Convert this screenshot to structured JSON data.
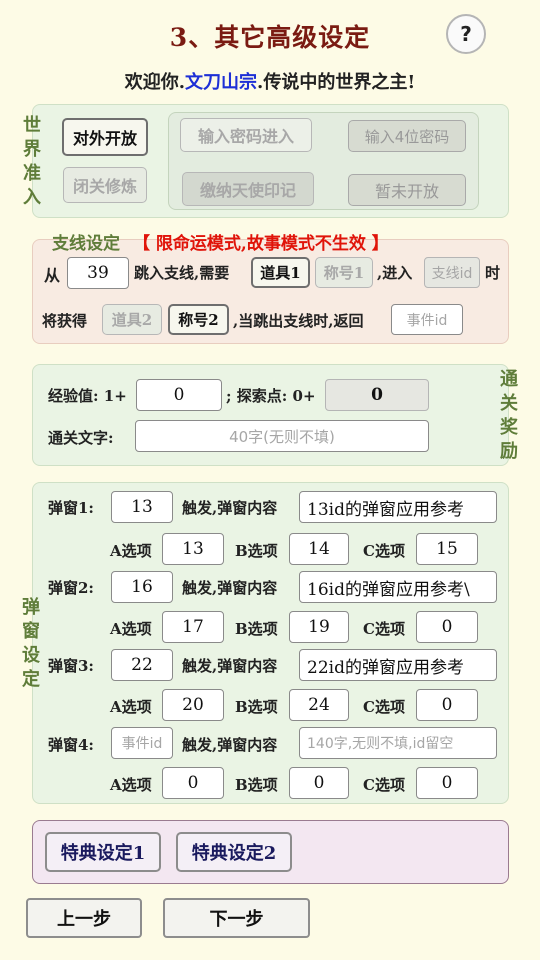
{
  "header": {
    "title": "3、其它高级设定",
    "help_label": "?",
    "welcome_prefix": "欢迎你.",
    "welcome_name": "文刀山宗",
    "welcome_suffix": ".传说中的世界之主!"
  },
  "world_access": {
    "side_label": [
      "世",
      "界",
      "准",
      "入"
    ],
    "open_button": "对外开放",
    "password_entry_button": "输入密码进入",
    "password_input_placeholder": "输入4位密码",
    "closed_button": "闭关修炼",
    "envoy_seal_button": "缴纳天使印记",
    "not_open_button": "暂未开放"
  },
  "branch": {
    "title": "支线设定",
    "warning": "【 限命运模式,故事模式不生效 】",
    "from_label": "从",
    "from_value": "39",
    "jump_label": "跳入支线,需要",
    "item1_button": "道具1",
    "title1_button": "称号1",
    "enter_label": ",进入",
    "branch_id_placeholder": "支线id",
    "when_label": "时",
    "gain_label": "将获得",
    "item2_button": "道具2",
    "title2_button": "称号2",
    "return_label": ",当跳出支线时,返回",
    "event_id_placeholder": "事件id"
  },
  "reward": {
    "side_label": [
      "通",
      "关",
      "奖",
      "励"
    ],
    "exp_label": "经验值: 1+",
    "exp_value": "0",
    "explore_label": "; 探索点: 0+",
    "explore_value": "0",
    "text_label": "通关文字:",
    "text_placeholder": "40字(无则不填)"
  },
  "popups": {
    "side_label": [
      "弹",
      "窗",
      "设",
      "定"
    ],
    "trigger_label": "触发,弹窗内容",
    "a_label": "A选项",
    "b_label": "B选项",
    "c_label": "C选项",
    "items": [
      {
        "label": "弹窗1:",
        "trigger": "13",
        "content": "13id的弹窗应用参考",
        "a": "13",
        "b": "14",
        "c": "15"
      },
      {
        "label": "弹窗2:",
        "trigger": "16",
        "content": "16id的弹窗应用参考\\",
        "a": "17",
        "b": "19",
        "c": "0"
      },
      {
        "label": "弹窗3:",
        "trigger": "22",
        "content": "22id的弹窗应用参考",
        "a": "20",
        "b": "24",
        "c": "0"
      },
      {
        "label": "弹窗4:",
        "trigger": "",
        "trigger_placeholder": "事件id",
        "content": "",
        "content_placeholder": "140字,无则不填,id留空",
        "a": "0",
        "b": "0",
        "c": "0"
      }
    ]
  },
  "special": {
    "setting1_button": "特典设定1",
    "setting2_button": "特典设定2"
  },
  "nav": {
    "prev_button": "上一步",
    "next_button": "下一步"
  },
  "colors": {
    "background": "#fdfbe6",
    "title": "#7a1b12",
    "welcome_name": "#1d2fd6",
    "warning": "#e0140a",
    "section_label": "#5f7d3a"
  }
}
